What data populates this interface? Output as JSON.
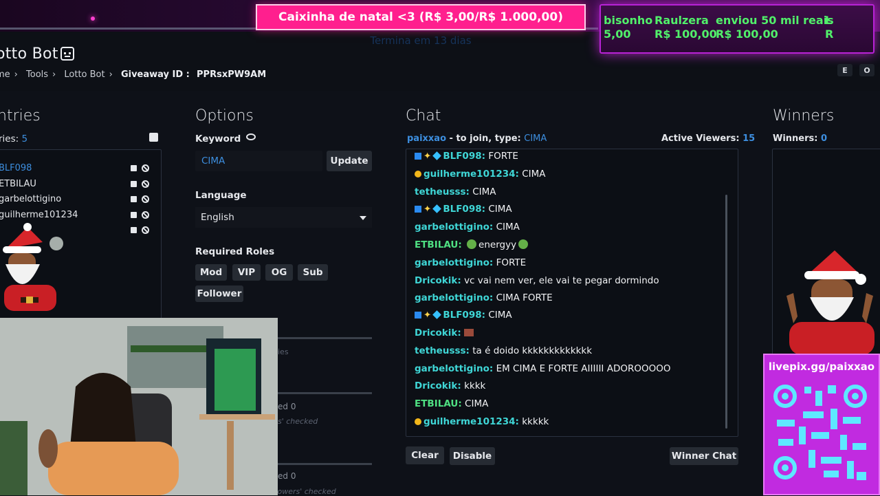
{
  "overlay": {
    "goal_banner": "Caixinha de natal <3 (R$ 3,00/R$ 1.000,00)",
    "goal_subtitle": "Termina em 13 dias",
    "donations": [
      {
        "name": "bisonho",
        "value": "5,00"
      },
      {
        "name": "Raulzera",
        "value": "R$ 100,00"
      },
      {
        "name": "enviou 50 mil reais",
        "value": "R$ 100,00"
      },
      {
        "name": "L",
        "value": "R"
      }
    ],
    "qr_link": "livepix.gg/paixxao"
  },
  "header": {
    "title": "otto Bot",
    "breadcrumb": [
      "me",
      "Tools",
      "Lotto Bot"
    ],
    "giveaway_label": "Giveaway ID :",
    "giveaway_id": "PPRsxPW9AM",
    "btn_e": "E",
    "btn_o": "O"
  },
  "entries": {
    "title": "ntries",
    "count_label": "ries:",
    "count": "5",
    "items": [
      "BLF098",
      "ETBILAU",
      "garbelottigino",
      "guilherme101234"
    ]
  },
  "options": {
    "title": "Options",
    "keyword_label": "Keyword",
    "keyword_value": "CIMA",
    "update_label": "Update",
    "language_label": "Language",
    "language_value": "English",
    "roles_label": "Required Roles",
    "roles": [
      "Mod",
      "VIP",
      "OG",
      "Sub",
      "Follower"
    ],
    "partial_1": "ies",
    "partial_2": "ed 0",
    "partial_3": "s' checked",
    "partial_4": "ed 0",
    "footnote": "only applies when followers' checked"
  },
  "chat": {
    "title": "Chat",
    "join_user": "paixxao",
    "join_text": "- to join, type:",
    "join_keyword": "CIMA",
    "viewers_label": "Active Viewers:",
    "viewers": "15",
    "messages": [
      {
        "user": "BLF098:",
        "text": "FORTE",
        "color": "tc",
        "badge": "sub"
      },
      {
        "user": "guilherme101234:",
        "text": "CIMA",
        "color": "tc",
        "badge": "gold"
      },
      {
        "user": "tetheusss:",
        "text": "CIMA",
        "color": "tc",
        "badge": ""
      },
      {
        "user": "BLF098:",
        "text": "CIMA",
        "color": "tc",
        "badge": "sub"
      },
      {
        "user": "garbelottigino:",
        "text": "CIMA",
        "color": "tc",
        "badge": ""
      },
      {
        "user": "ETBILAU:",
        "text": "energyy",
        "color": "tg",
        "badge": "",
        "emote": true
      },
      {
        "user": "garbelottigino:",
        "text": "FORTE",
        "color": "tc",
        "badge": ""
      },
      {
        "user": "Dricokik:",
        "text": "vc vai nem ver, ele vai te pegar dormindo",
        "color": "tc",
        "badge": ""
      },
      {
        "user": "garbelottigino:",
        "text": "CIMA FORTE",
        "color": "tc",
        "badge": ""
      },
      {
        "user": "BLF098:",
        "text": "CIMA",
        "color": "tc",
        "badge": "sub"
      },
      {
        "user": "Dricokik:",
        "text": "",
        "color": "tc",
        "badge": "",
        "brick": true
      },
      {
        "user": "tetheusss:",
        "text": "ta é doido kkkkkkkkkkkkk",
        "color": "tc",
        "badge": ""
      },
      {
        "user": "garbelottigino:",
        "text": "EM CIMA E FORTE AIIIIII ADOROOOOO",
        "color": "tc",
        "badge": ""
      },
      {
        "user": "Dricokik:",
        "text": "kkkk",
        "color": "tc",
        "badge": ""
      },
      {
        "user": "ETBILAU:",
        "text": "CIMA",
        "color": "tg",
        "badge": ""
      },
      {
        "user": "guilherme101234:",
        "text": "kkkkk",
        "color": "tc",
        "badge": "gold"
      }
    ],
    "clear_label": "Clear",
    "disable_label": "Disable",
    "winner_chat_label": "Winner Chat"
  },
  "winners": {
    "title": "Winners",
    "count_label": "Winners:",
    "count": "0"
  }
}
